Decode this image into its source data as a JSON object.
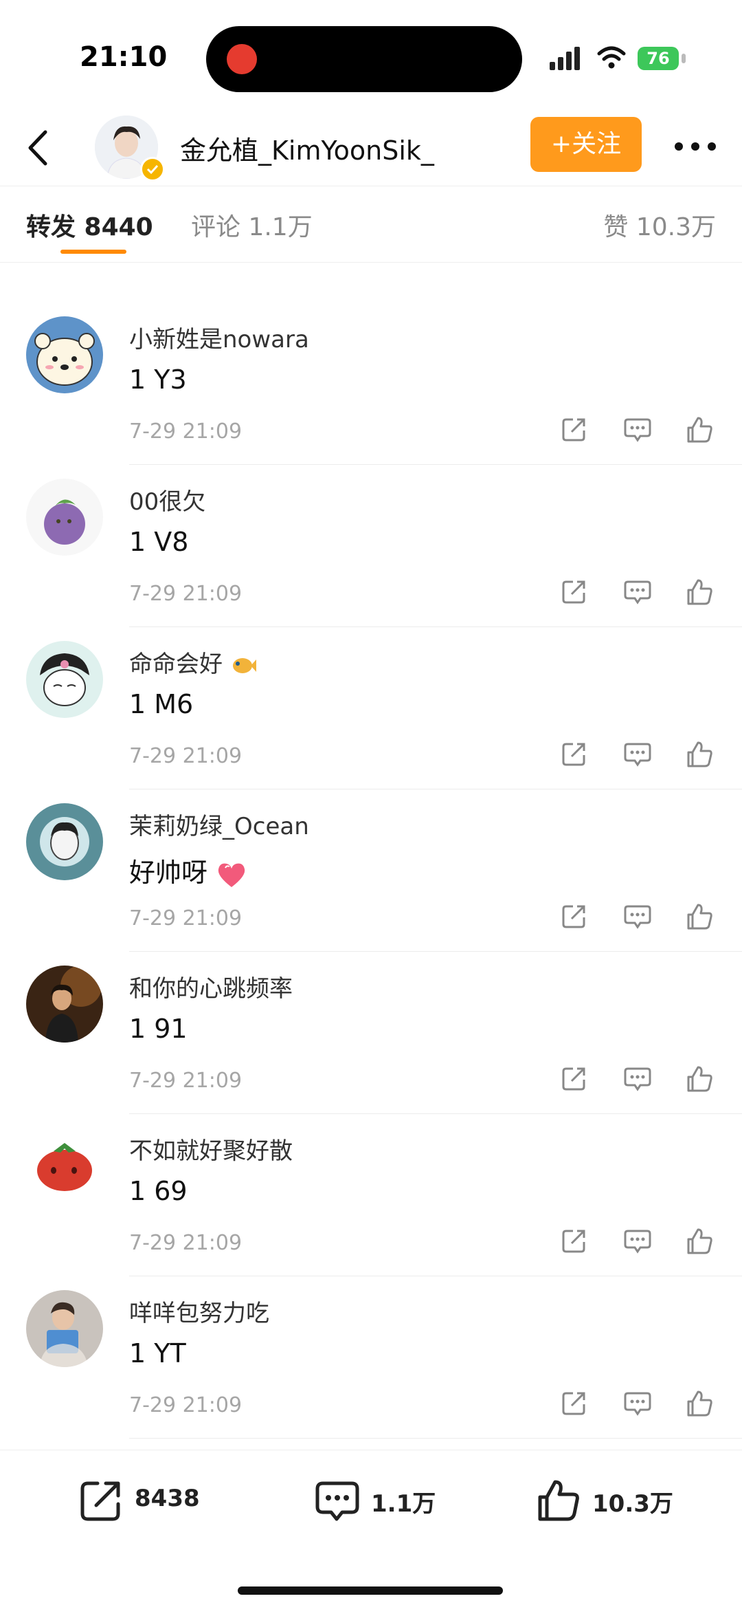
{
  "status_bar": {
    "time": "21:10",
    "battery": "76"
  },
  "header": {
    "author_name": "金允植_KimYoonSik_",
    "follow_label": "+关注"
  },
  "tabs": {
    "repost": "转发 8440",
    "comments": "评论 1.1万",
    "likes": "赞 10.3万"
  },
  "comments": [
    {
      "user": "小新姓是nowara",
      "text": "1 Y3",
      "time": "7-29 21:09"
    },
    {
      "user": "00很欠",
      "text": "1 V8",
      "time": "7-29 21:09"
    },
    {
      "user": "命命会好",
      "text": "1 M6",
      "time": "7-29 21:09"
    },
    {
      "user": "茉莉奶绿_Ocean",
      "text": "好帅呀",
      "time": "7-29 21:09"
    },
    {
      "user": "和你的心跳频率",
      "text": "1 91",
      "time": "7-29 21:09"
    },
    {
      "user": "不如就好聚好散",
      "text": "1 69",
      "time": "7-29 21:09"
    },
    {
      "user": "咩咩包努力吃",
      "text": "1 YT",
      "time": "7-29 21:09"
    }
  ],
  "bottom_bar": {
    "repost_count": "8438",
    "comment_count": "1.1万",
    "like_count": "10.3万"
  },
  "colors": {
    "accent": "#ff9a1c",
    "tab_underline": "#ff8a00",
    "rec": "#e53b2f"
  }
}
